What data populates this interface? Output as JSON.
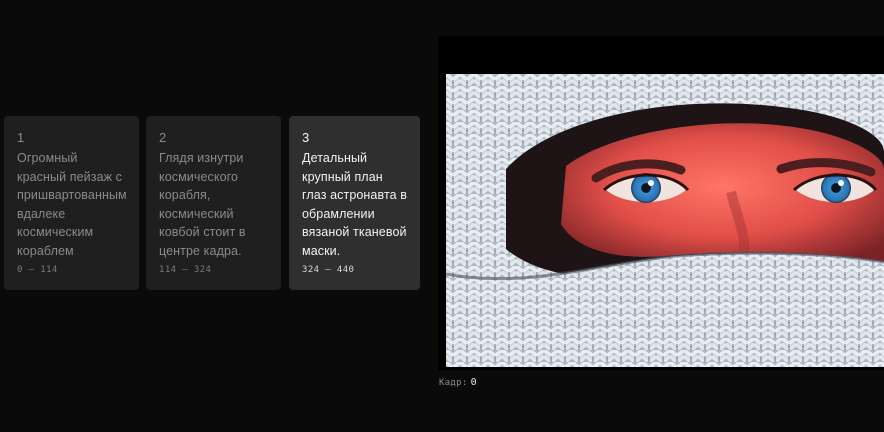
{
  "shots": [
    {
      "number": "1",
      "description": "Огромный красный пейзаж с пришвартованным вдалеке космическим кораблем",
      "range": "0 – 114",
      "active": false
    },
    {
      "number": "2",
      "description": "Глядя изнутри космического корабля, космический ковбой стоит в центре кадра.",
      "range": "114 – 324",
      "active": false
    },
    {
      "number": "3",
      "description": "Детальный крупный план глаз астронавта в обрамлении вязаной тканевой маски.",
      "range": "324 – 440",
      "active": true
    }
  ],
  "preview": {
    "frame_label": "Кадр:",
    "frame_value": "0"
  },
  "colors": {
    "background": "#0a0a0a",
    "card_inactive": "#1f1f1f",
    "card_active": "#2f2f2f",
    "eye_blue": "#3a8fd1"
  }
}
